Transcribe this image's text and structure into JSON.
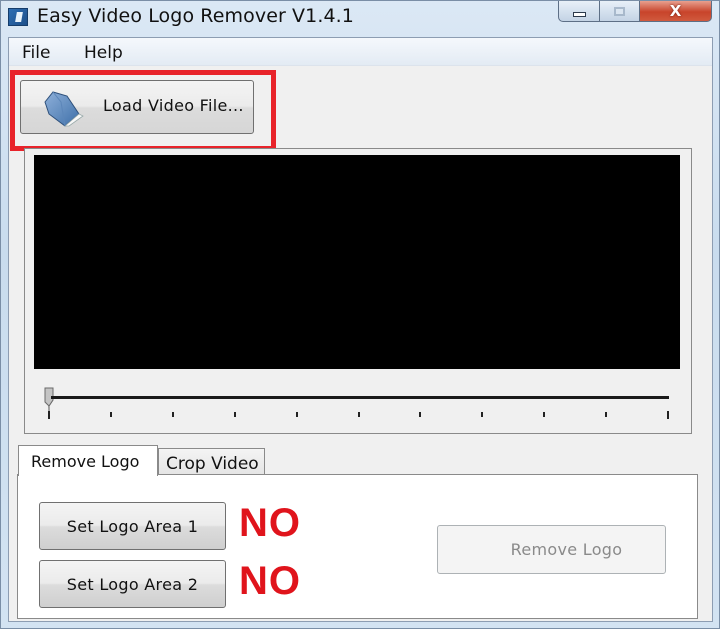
{
  "window": {
    "title": "Easy Video Logo Remover V1.4.1",
    "app_icon": "app-logo-icon",
    "caption_buttons": [
      {
        "name": "minimize",
        "icon": "minimize-icon"
      },
      {
        "name": "maximize",
        "icon": "maximize-icon"
      },
      {
        "name": "close",
        "icon": "close-icon",
        "glyph": "X"
      }
    ]
  },
  "menu": {
    "items": [
      {
        "label": "File"
      },
      {
        "label": "Help"
      }
    ]
  },
  "toolbar": {
    "load_label": "Load Video File...",
    "load_icon": "folder-icon",
    "highlight_color": "#e8232a"
  },
  "player": {
    "video_background": "#000000",
    "slider_position": 0,
    "tick_count": 11
  },
  "tabs": [
    {
      "label": "Remove Logo",
      "active": true
    },
    {
      "label": "Crop Video",
      "active": false
    }
  ],
  "remove_logo_panel": {
    "set_area_1_label": "Set Logo Area 1",
    "set_area_2_label": "Set Logo Area 2",
    "area_1_status": "NO",
    "area_2_status": "NO",
    "status_color": "#e0141c",
    "remove_button_label": "Remove Logo",
    "remove_button_enabled": false
  }
}
